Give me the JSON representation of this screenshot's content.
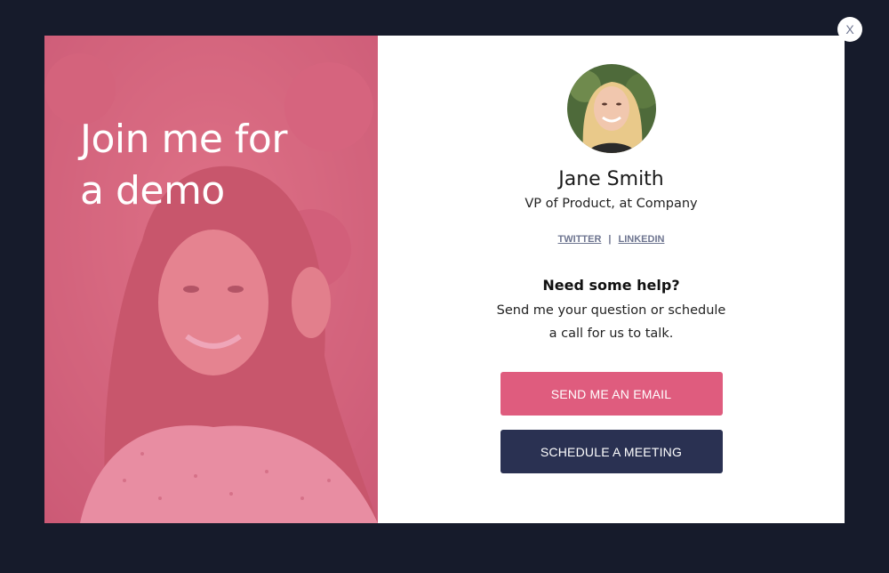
{
  "close_label": "X",
  "left_panel": {
    "headline": "Join me for\na demo"
  },
  "profile": {
    "name": "Jane Smith",
    "title": "VP of Product, at Company"
  },
  "social": {
    "twitter": "TWITTER",
    "separator": "|",
    "linkedin": "LINKEDIN"
  },
  "help": {
    "heading": "Need some help?",
    "text": "Send me your question or schedule a call for us to talk."
  },
  "buttons": {
    "email": "SEND ME AN EMAIL",
    "meeting": "SCHEDULE A MEETING"
  },
  "colors": {
    "page_background": "#161b2b",
    "accent_pink": "#df5c7e",
    "navy": "#2a3152",
    "link_gray": "#6e7590"
  }
}
